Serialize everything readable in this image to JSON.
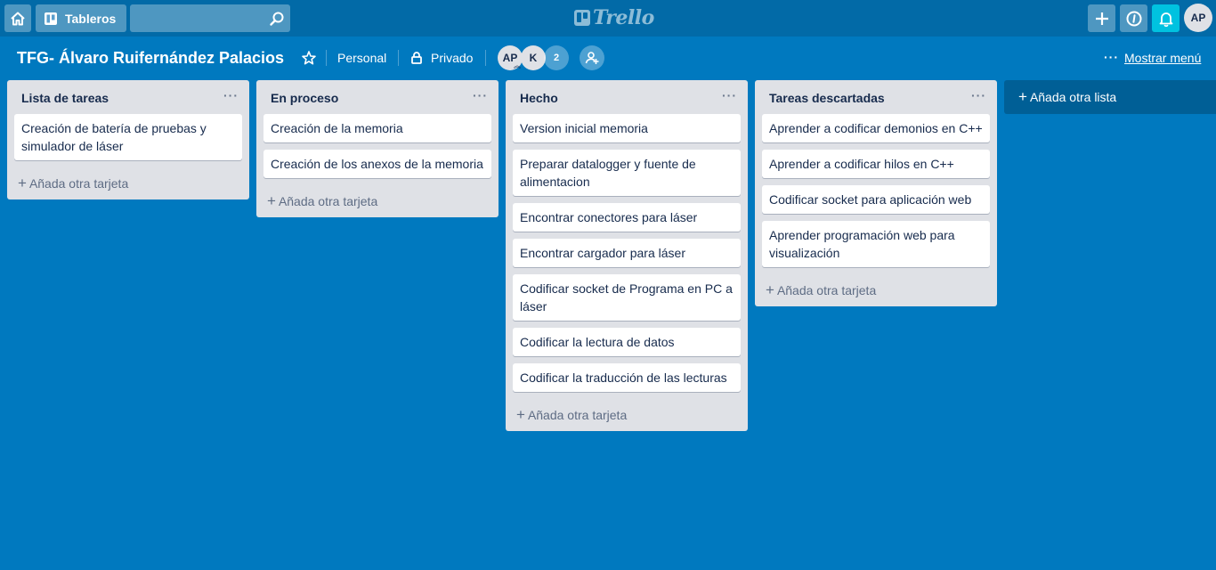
{
  "header": {
    "boards_label": "Tableros",
    "logo_text": "Trello",
    "user_initials": "AP"
  },
  "board": {
    "title": "TFG- Álvaro Ruifernández Palacios",
    "team": "Personal",
    "visibility": "Privado",
    "members": [
      "AP",
      "K"
    ],
    "member_count": "2",
    "menu_dots": "···",
    "show_menu": "Mostrar menú"
  },
  "lists": [
    {
      "title": "Lista de tareas",
      "cards": [
        "Creación de batería de pruebas y simulador de láser"
      ],
      "add_card": "Añada otra tarjeta"
    },
    {
      "title": "En proceso",
      "cards": [
        "Creación de la memoria",
        "Creación de los anexos de la memoria"
      ],
      "add_card": "Añada otra tarjeta"
    },
    {
      "title": "Hecho",
      "cards": [
        "Version inicial memoria",
        "Preparar datalogger y fuente de alimentacion",
        "Encontrar conectores para láser",
        "Encontrar cargador para láser",
        "Codificar socket de Programa en PC a láser",
        "Codificar la lectura de datos",
        "Codificar la traducción de las lecturas"
      ],
      "add_card": "Añada otra tarjeta"
    },
    {
      "title": "Tareas descartadas",
      "cards": [
        "Aprender a codificar demonios en C++",
        "Aprender a codificar hilos en C++",
        "Codificar socket para aplicación web",
        "Aprender programación web para visualización"
      ],
      "add_card": "Añada otra tarjeta"
    }
  ],
  "list_more": "···",
  "add_list": "Añada otra lista",
  "plus_sign": "+",
  "colors": {
    "board_bg": "#0079bf",
    "header_bg": "#026aa7",
    "list_bg": "#dfe1e6",
    "notification": "#00c2e0"
  },
  "icons": [
    "home-icon",
    "boards-icon",
    "search-icon",
    "plus-icon",
    "info-icon",
    "bell-icon",
    "star-icon",
    "lock-icon",
    "add-member-icon"
  ]
}
